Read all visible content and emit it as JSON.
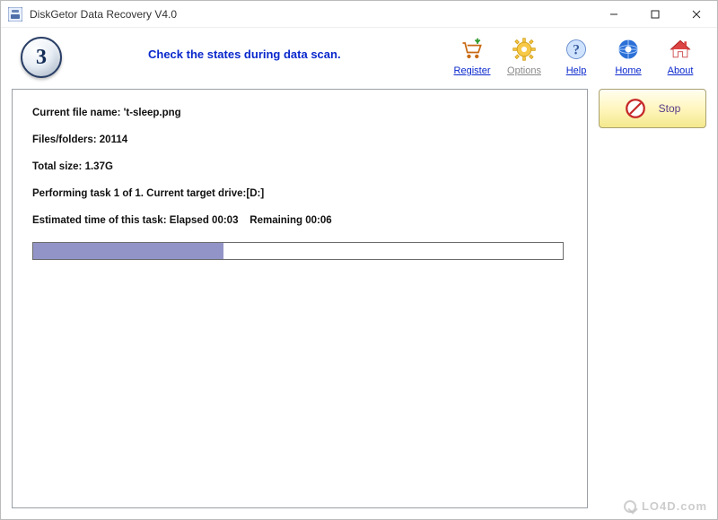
{
  "window": {
    "title": "DiskGetor Data Recovery  V4.0"
  },
  "header": {
    "step_number": "3",
    "instruction": "Check the states during data scan."
  },
  "toolbar": {
    "register": "Register",
    "options": "Options",
    "help": "Help",
    "home": "Home",
    "about": "About"
  },
  "scan": {
    "current_file_label": "Current file name:",
    "current_file_value": "'t-sleep.png",
    "files_folders_label": "Files/folders:",
    "files_folders_value": "20114",
    "total_size_label": "Total size:",
    "total_size_value": "1.37G",
    "task_line": "Performing task 1 of 1. Current target drive:[D:]",
    "est_label": "Estimated time of this task:",
    "elapsed": "Elapsed 00:03",
    "remaining": "Remaining 00:06",
    "progress_percent": 36
  },
  "actions": {
    "stop_label": "Stop"
  },
  "watermark": {
    "text": "LO4D.com"
  }
}
